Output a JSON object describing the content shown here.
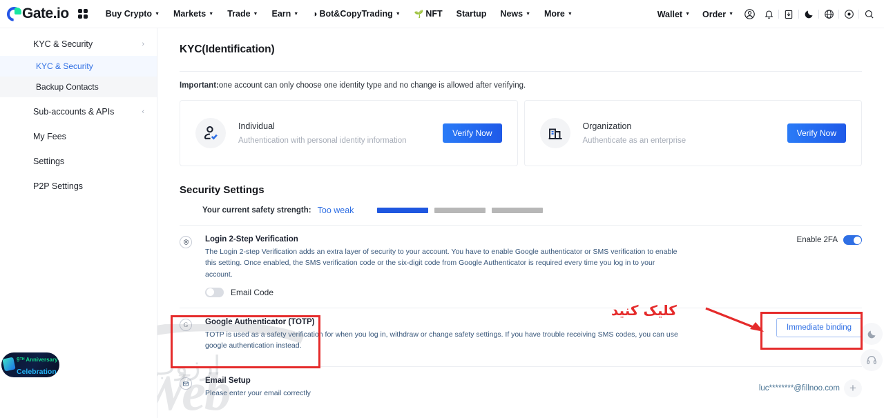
{
  "header": {
    "logo_text": "Gate.io",
    "logo_icon": "gate-logo-icon",
    "apps_icon": "apps-grid-icon",
    "nav": [
      {
        "label": "Buy Crypto",
        "caret": true
      },
      {
        "label": "Markets",
        "caret": true
      },
      {
        "label": "Trade",
        "caret": true
      },
      {
        "label": "Earn",
        "caret": true
      },
      {
        "label": "Bot&CopyTrading",
        "caret": true,
        "glyph": "bot-icon"
      },
      {
        "label": "NFT",
        "caret": false,
        "glyph": "leaf-icon"
      },
      {
        "label": "Startup",
        "caret": false
      },
      {
        "label": "News",
        "caret": true
      },
      {
        "label": "More",
        "caret": true
      }
    ],
    "right_text": [
      {
        "label": "Wallet",
        "caret": true
      },
      {
        "label": "Order",
        "caret": true
      }
    ],
    "right_icons": [
      "account-icon",
      "bell-icon",
      "download-icon",
      "dark-mode-icon",
      "language-globe-icon",
      "settings-circle-icon",
      "search-icon"
    ]
  },
  "sidebar": {
    "items": [
      {
        "label": "KYC & Security",
        "type": "group",
        "chevron": "chevron-right-icon"
      },
      {
        "label": "KYC & Security",
        "type": "sub-active"
      },
      {
        "label": "Backup Contacts",
        "type": "sub"
      },
      {
        "label": "Sub-accounts & APIs",
        "type": "group",
        "chevron": "chevron-left-icon"
      },
      {
        "label": "My Fees",
        "type": "group"
      },
      {
        "label": "Settings",
        "type": "group"
      },
      {
        "label": "P2P Settings",
        "type": "group"
      }
    ]
  },
  "main": {
    "page_title": "KYC(Identification)",
    "important_bold": "Important:",
    "important_text": "one account can only choose one identity type and no change is allowed after verifying.",
    "kyc_cards": [
      {
        "icon": "individual-person-icon",
        "name": "Individual",
        "desc": "Authentication with personal identity information",
        "button": "Verify Now"
      },
      {
        "icon": "organization-building-icon",
        "name": "Organization",
        "desc": "Authenticate as an enterprise",
        "button": "Verify Now"
      }
    ],
    "security_title": "Security Settings",
    "strength": {
      "label": "Your current safety strength:",
      "value": "Too weak",
      "segments_total": 3,
      "segments_filled": 1,
      "filled_color": "#1f57e0",
      "empty_color": "#b7b7b7"
    },
    "rows": [
      {
        "icon": "shield-lock-icon",
        "title": "Login 2-Step Verification",
        "desc": "The Login 2-step Verification adds an extra layer of security to your account. You have to enable Google authenticator or SMS verification to enable this setting. Once enabled, the SMS verification code or the six-digit code from Google Authenticator is required every time you log in to your account.",
        "toggle_label": "Email Code",
        "toggle_on": false,
        "right_label": "Enable 2FA",
        "right_toggle_on": true
      },
      {
        "icon": "google-g-icon",
        "title": "Google Authenticator (TOTP)",
        "desc": "TOTP is used as a safety verification for when you log in, withdraw or change safety settings. If you have trouble receiving SMS codes, you can use google authentication instead.",
        "right_button": "Immediate binding"
      },
      {
        "icon": "envelope-icon",
        "title": "Email Setup",
        "desc": "Please enter your email correctly",
        "right_value": "luc********@fillnoo.com",
        "right_plus": "plus-icon"
      }
    ]
  },
  "annotations": {
    "callout_text": "کلیک کنید",
    "color": "#e52b2b",
    "boxes": [
      "google-authenticator-row-box",
      "immediate-binding-button-box"
    ],
    "arrow": "red-arrow-icon"
  },
  "overlays": {
    "anniversary_year": "9ᵀᴴ Anniversary",
    "anniversary_label": "Celebration",
    "watermark_latin": "ArzWeb",
    "watermark_persian": "ارزوب",
    "money_bag_icon": "money-bag-icon"
  },
  "float_buttons": [
    {
      "icon": "theme-moon-icon"
    },
    {
      "icon": "headset-support-icon"
    }
  ]
}
